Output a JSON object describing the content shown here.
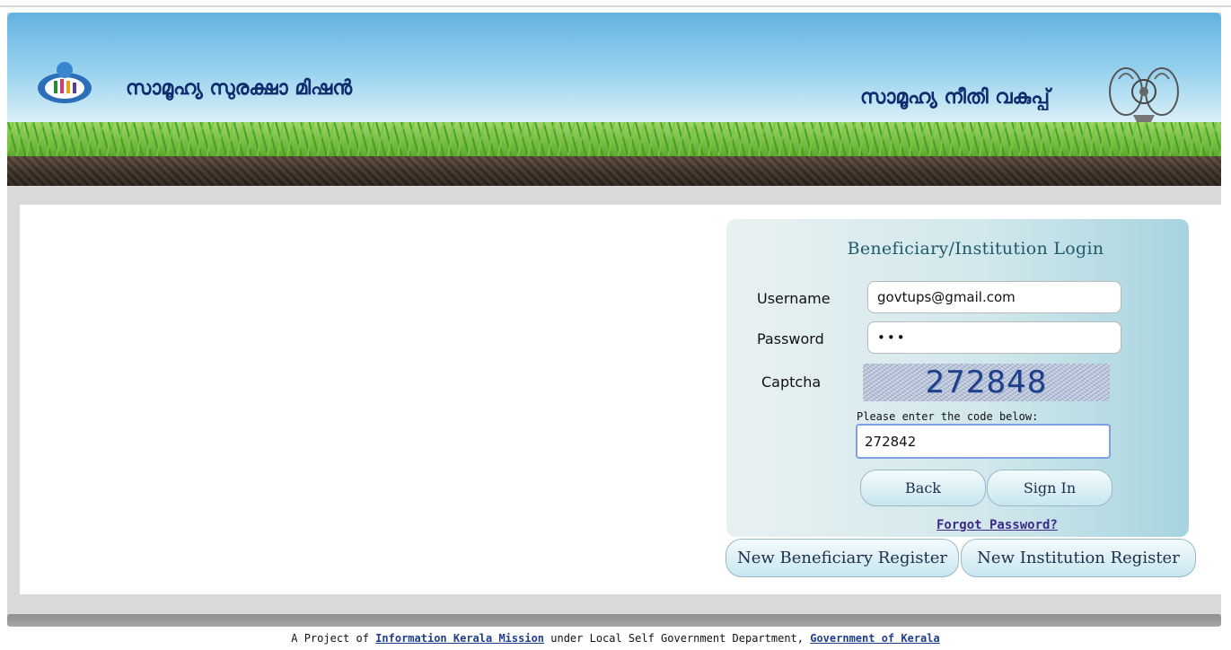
{
  "header": {
    "brand_left": "സാമൂഹ്യ സുരക്ഷാ മിഷൻ",
    "brand_right": "സാമൂഹ്യ നീതി വകുപ്പ്"
  },
  "login": {
    "title": "Beneficiary/Institution Login",
    "username_label": "Username",
    "username_value": "govtups@gmail.com",
    "password_label": "Password",
    "password_value": "•••",
    "captcha_label": "Captcha",
    "captcha_image_text": "272848",
    "code_hint": "Please enter the code below:",
    "code_value": "272842",
    "back_label": "Back",
    "signin_label": "Sign In",
    "forgot_label": "Forgot Password?"
  },
  "register": {
    "beneficiary_label": "New Beneficiary Register",
    "institution_label": "New Institution Register"
  },
  "footer": {
    "prefix": "A Project of ",
    "link1": "Information Kerala Mission",
    "middle": " under Local Self Government Department, ",
    "link2": "Government of Kerala"
  },
  "colors": {
    "brand_text": "#0f2d6e",
    "panel_title": "#1d5a6a",
    "link": "#1f3f8c"
  }
}
